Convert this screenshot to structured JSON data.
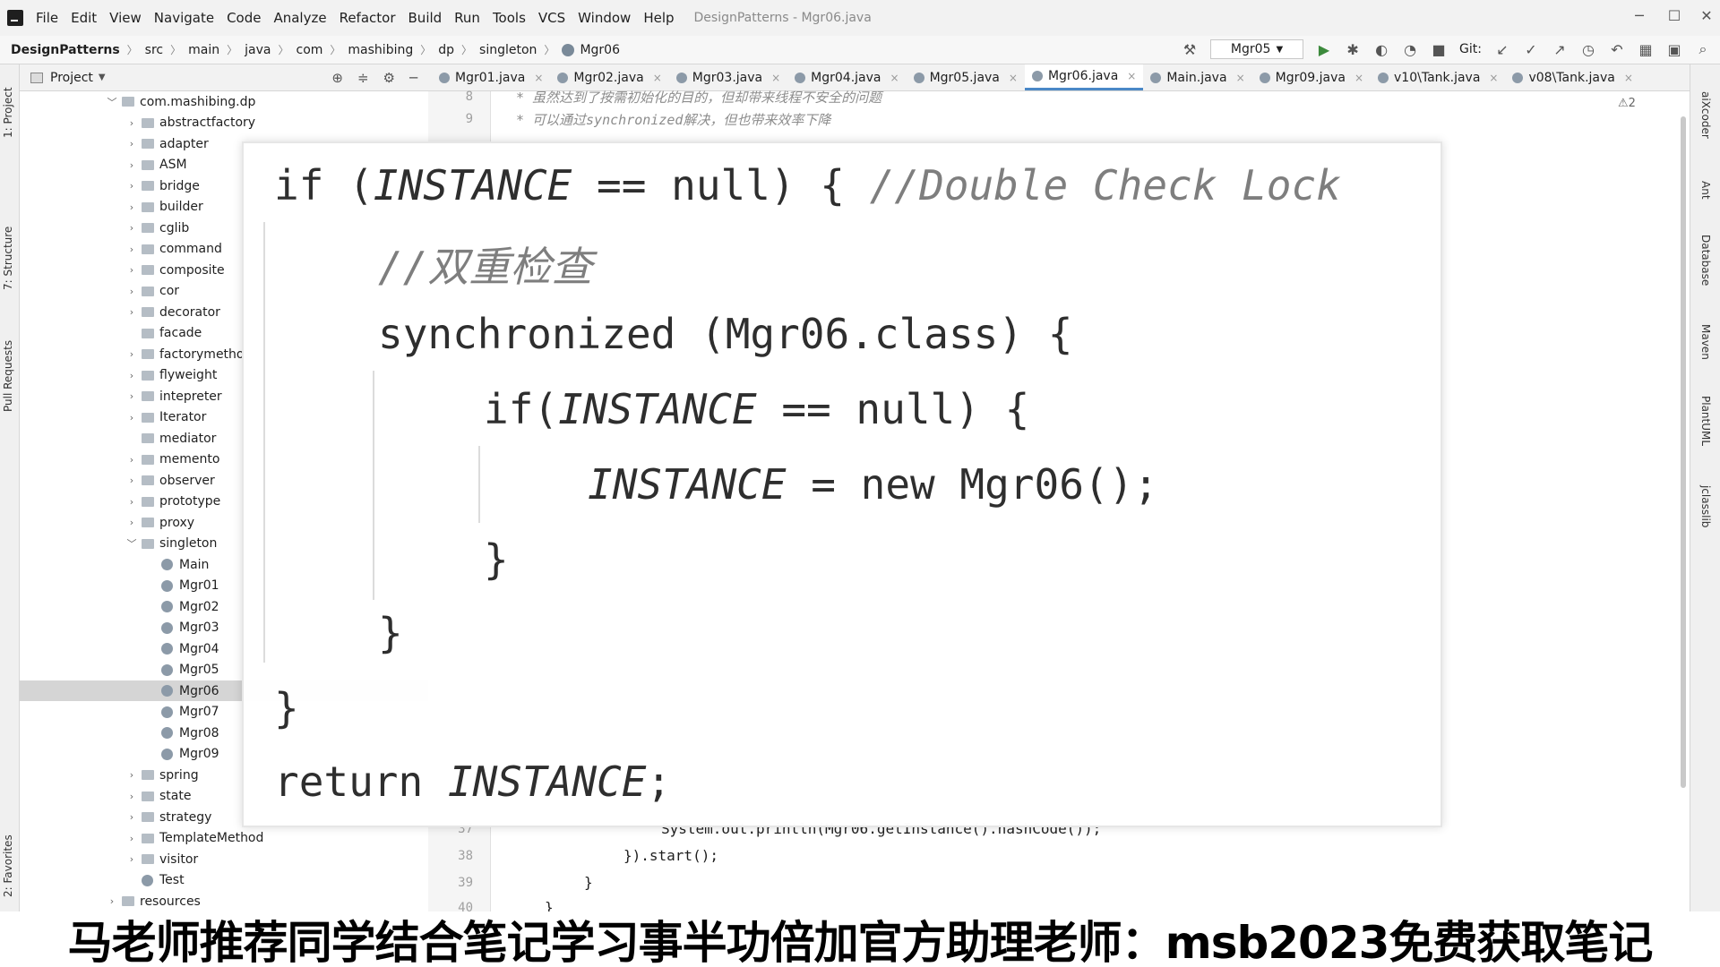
{
  "menubar": {
    "items": [
      "File",
      "Edit",
      "View",
      "Navigate",
      "Code",
      "Analyze",
      "Refactor",
      "Build",
      "Run",
      "Tools",
      "VCS",
      "Window",
      "Help"
    ],
    "window_title": "DesignPatterns - Mgr06.java"
  },
  "navbar": {
    "breadcrumbs": [
      "DesignPatterns",
      "src",
      "main",
      "java",
      "com",
      "mashibing",
      "dp",
      "singleton",
      "Mgr06"
    ],
    "run_config": "Mgr05",
    "git_label": "Git:"
  },
  "left_strip": [
    "1: Project",
    "7: Structure",
    "Pull Requests",
    "2: Favorites"
  ],
  "right_strip": [
    "aiXcoder",
    "Ant",
    "Database",
    "Maven",
    "PlantUML",
    "jclasslib"
  ],
  "project": {
    "title": "Project",
    "tree": [
      {
        "label": "com.mashibing.dp",
        "kind": "folder",
        "depth": 0,
        "expanded": true
      },
      {
        "label": "abstractfactory",
        "kind": "folder",
        "depth": 1
      },
      {
        "label": "adapter",
        "kind": "folder",
        "depth": 1
      },
      {
        "label": "ASM",
        "kind": "folder",
        "depth": 1
      },
      {
        "label": "bridge",
        "kind": "folder",
        "depth": 1
      },
      {
        "label": "builder",
        "kind": "folder",
        "depth": 1
      },
      {
        "label": "cglib",
        "kind": "folder",
        "depth": 1
      },
      {
        "label": "command",
        "kind": "folder",
        "depth": 1
      },
      {
        "label": "composite",
        "kind": "folder",
        "depth": 1
      },
      {
        "label": "cor",
        "kind": "folder",
        "depth": 1
      },
      {
        "label": "decorator",
        "kind": "folder",
        "depth": 1
      },
      {
        "label": "facade",
        "kind": "folder",
        "depth": 1,
        "noarrow": true
      },
      {
        "label": "factorymetho",
        "kind": "folder",
        "depth": 1
      },
      {
        "label": "flyweight",
        "kind": "folder",
        "depth": 1
      },
      {
        "label": "intepreter",
        "kind": "folder",
        "depth": 1
      },
      {
        "label": "Iterator",
        "kind": "folder",
        "depth": 1
      },
      {
        "label": "mediator",
        "kind": "folder",
        "depth": 1,
        "noarrow": true
      },
      {
        "label": "memento",
        "kind": "folder",
        "depth": 1
      },
      {
        "label": "observer",
        "kind": "folder",
        "depth": 1
      },
      {
        "label": "prototype",
        "kind": "folder",
        "depth": 1
      },
      {
        "label": "proxy",
        "kind": "folder",
        "depth": 1
      },
      {
        "label": "singleton",
        "kind": "folder",
        "depth": 1,
        "expanded": true
      },
      {
        "label": "Main",
        "kind": "class",
        "depth": 2
      },
      {
        "label": "Mgr01",
        "kind": "class",
        "depth": 2
      },
      {
        "label": "Mgr02",
        "kind": "class",
        "depth": 2
      },
      {
        "label": "Mgr03",
        "kind": "class",
        "depth": 2
      },
      {
        "label": "Mgr04",
        "kind": "class",
        "depth": 2
      },
      {
        "label": "Mgr05",
        "kind": "class",
        "depth": 2
      },
      {
        "label": "Mgr06",
        "kind": "class",
        "depth": 2,
        "selected": true
      },
      {
        "label": "Mgr07",
        "kind": "class",
        "depth": 2
      },
      {
        "label": "Mgr08",
        "kind": "class",
        "depth": 2
      },
      {
        "label": "Mgr09",
        "kind": "class",
        "depth": 2
      },
      {
        "label": "spring",
        "kind": "folder",
        "depth": 1
      },
      {
        "label": "state",
        "kind": "folder",
        "depth": 1
      },
      {
        "label": "strategy",
        "kind": "folder",
        "depth": 1
      },
      {
        "label": "TemplateMethod",
        "kind": "folder",
        "depth": 1
      },
      {
        "label": "visitor",
        "kind": "folder",
        "depth": 1
      },
      {
        "label": "Test",
        "kind": "class",
        "depth": 1
      },
      {
        "label": "resources",
        "kind": "folder",
        "depth": 0
      }
    ]
  },
  "tabs": [
    {
      "label": "Mgr01.java"
    },
    {
      "label": "Mgr02.java"
    },
    {
      "label": "Mgr03.java"
    },
    {
      "label": "Mgr04.java"
    },
    {
      "label": "Mgr05.java"
    },
    {
      "label": "Mgr06.java",
      "active": true
    },
    {
      "label": "Main.java"
    },
    {
      "label": "Mgr09.java"
    },
    {
      "label": "v10\\Tank.java"
    },
    {
      "label": "v08\\Tank.java"
    }
  ],
  "editor": {
    "warning_count": "⚠2",
    "top_lines": [
      {
        "num": "8",
        "text": "* 虽然达到了按需初始化的目的，但却带来线程不安全的问题"
      },
      {
        "num": "9",
        "text": "* 可以通过synchronized解决，但也带来效率下降"
      }
    ],
    "bottom_lines": [
      {
        "num": "37",
        "text": "System.out.println(Mgr06.getInstance().hashCode());"
      },
      {
        "num": "38",
        "text": "}).start();"
      },
      {
        "num": "39",
        "text": "}"
      },
      {
        "num": "40",
        "text": "}"
      }
    ]
  },
  "zoom": {
    "line1_a": "if (",
    "line1_b": "INSTANCE",
    "line1_c": " == null) { ",
    "line1_comment": "//Double Check Lock",
    "line2_comment": "//双重检查",
    "line3": "synchronized (Mgr06.class) {",
    "line4_a": "if(",
    "line4_b": "INSTANCE",
    "line4_c": " == null) {",
    "line5_a": "INSTANCE",
    "line5_b": " = new Mgr06();",
    "line6": "}",
    "line7": "}",
    "line8": "}",
    "line9_a": "return ",
    "line9_b": "INSTANCE",
    "line9_c": ";"
  },
  "banner": "马老师推荐同学结合笔记学习事半功倍加官方助理老师：msb2023免费获取笔记"
}
